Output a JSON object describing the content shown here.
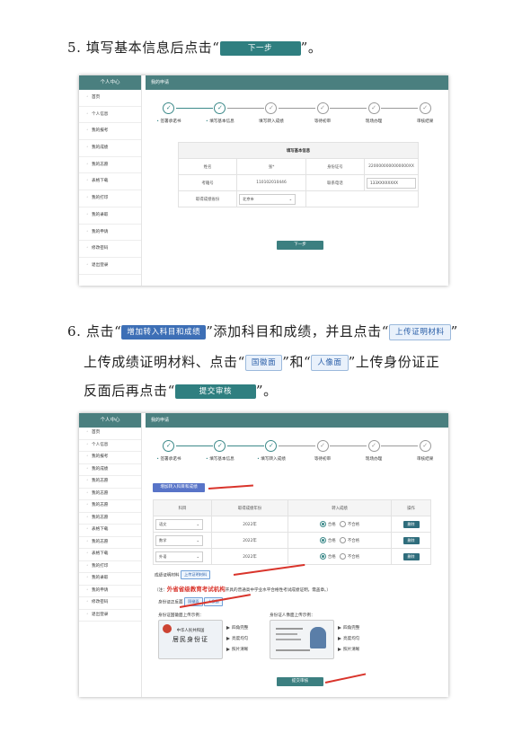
{
  "step5": {
    "text_before": "5. 填写基本信息后点击“",
    "button": "下一步",
    "text_after": "”。"
  },
  "step6": {
    "line1_a": "6. 点击“",
    "add_button": "增加转入科目和成绩",
    "line1_b": "”添加科目和成绩，并且点击“",
    "upload_button": "上传证明材料",
    "line1_c": "”",
    "line2_a": "上传成绩证明材料、点击“",
    "emblem_button": "国徽面",
    "line2_b": "”和“",
    "portrait_button": "人像面",
    "line2_c": "”上传身份证正",
    "line3_a": "反面后再点击“",
    "submit_button": "提交审核",
    "line3_b": "”。"
  },
  "sidebar1": {
    "title": "个人中心",
    "items": [
      "首页",
      "个人信息",
      "我的报考",
      "我的成绩",
      "我的志愿",
      "表格下载",
      "我的打印",
      "我的录取",
      "我的申请",
      "修改密码",
      "退出登录"
    ]
  },
  "sidebar2": {
    "title": "个人中心",
    "items": [
      "首页",
      "个人信息",
      "我的报考",
      "我的成绩",
      "我的志愿",
      "我的志愿",
      "我的志愿",
      "我的志愿",
      "表格下载",
      "我的志愿",
      "表格下载",
      "我的打印",
      "我的录取",
      "我的申请",
      "修改密码",
      "退出登录"
    ]
  },
  "shot1": {
    "header": "我的申请",
    "steps": [
      "签署承诺书",
      "填写基本信息",
      "填写转入成绩",
      "等待初审",
      "现场办理",
      "审核结果"
    ],
    "form_title": "填写基本信息",
    "name_label": "姓名",
    "name_value": "张*",
    "id_label": "身份证号",
    "id_value": "2200000000000000XX",
    "exam_no_label": "考籍号",
    "exam_no_value": "110102010446",
    "phone_label": "联系电话",
    "phone_value": "133XXXXXXXX",
    "region_label": "取得成绩省份",
    "region_value": "北京市",
    "next_button": "下一步"
  },
  "shot2": {
    "header": "我的申请",
    "steps": [
      "签署承诺书",
      "填写基本信息",
      "填写转入成绩",
      "等待初审",
      "现场办理",
      "审核结果"
    ],
    "add_button": "增加转入科目和成绩",
    "col_subject": "科目",
    "col_year": "取得成绩年份",
    "col_result": "转入成绩",
    "col_action": "操作",
    "rows": [
      {
        "subject": "语文",
        "year": "2022年",
        "pass": "合格",
        "fail": "不合格",
        "action": "删除"
      },
      {
        "subject": "数学",
        "year": "2022年",
        "pass": "合格",
        "fail": "不合格",
        "action": "删除"
      },
      {
        "subject": "外语",
        "year": "2022年",
        "pass": "合格",
        "fail": "不合格",
        "action": "删除"
      }
    ],
    "material_label": "成绩证明材料",
    "upload_button": "上传证明材料",
    "note_prefix": "（注：",
    "note_highlight": "外省省级教育考试机构",
    "note_suffix": "开具的普通高中学业水平合格性考试成绩证明，需盖章。）",
    "id_label": "身份证正反面",
    "emblem_button": "国徽面",
    "portrait_button": "人像面",
    "emblem_example": "身份证国徽面上传示例：",
    "portrait_example": "身份证人像面上传示例：",
    "card_title1": "中华人民共和国",
    "card_title2": "居民身份证",
    "checks": [
      "四角完整",
      "亮度均匀",
      "照片清晰"
    ],
    "submit_button": "提交审核"
  },
  "colors": {
    "accent": "#4a7f7f",
    "button": "#2f7f80",
    "red": "#d9342b",
    "blue": "#3d6fb6"
  }
}
